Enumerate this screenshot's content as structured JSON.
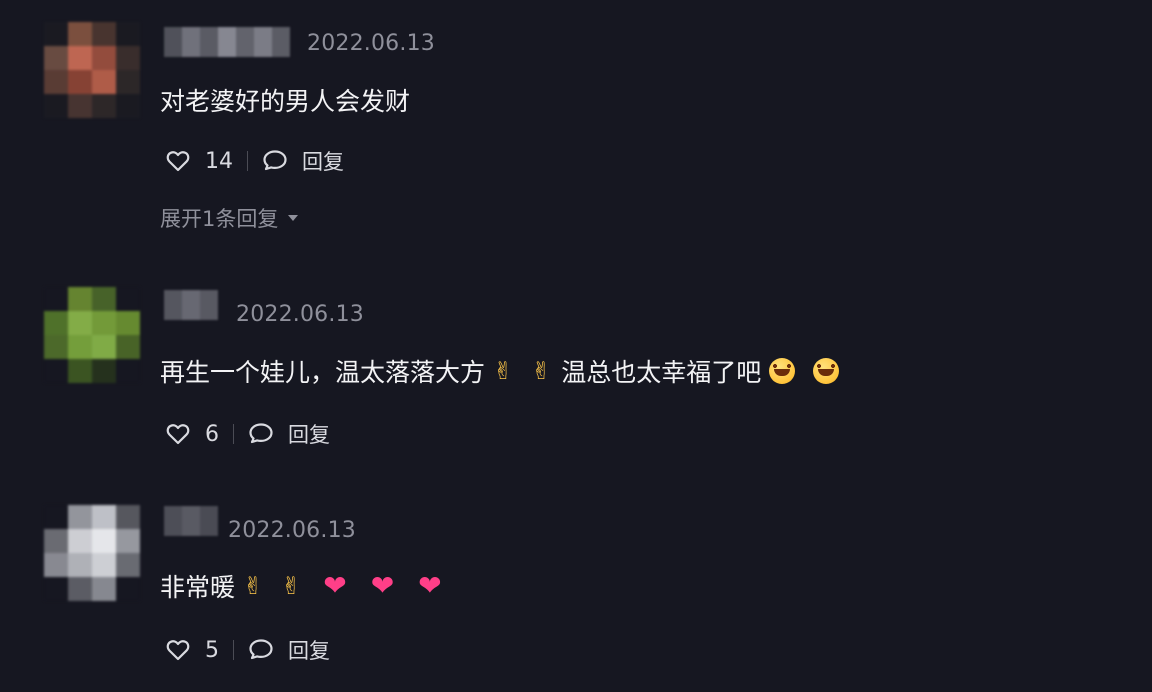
{
  "comments": [
    {
      "date": "2022.06.13",
      "text": "对老婆好的男人会发财",
      "likes": "14",
      "reply_label": "回复",
      "expand_label": "展开1条回复"
    },
    {
      "date": "2022.06.13",
      "text_part1": "再生一个娃儿，温太落落大方",
      "text_part2": "温总也太幸福了吧",
      "likes": "6",
      "reply_label": "回复"
    },
    {
      "date": "2022.06.13",
      "text": "非常暖",
      "likes": "5",
      "reply_label": "回复"
    }
  ],
  "colors": {
    "background": "#161721",
    "date_text": "#8f909b",
    "comment_text": "#f3f3f5",
    "action_text": "#d9dae0",
    "heart_emoji": "#ff3f88"
  },
  "icons": {
    "like": "heart-outline-icon",
    "reply": "speech-bubble-icon",
    "dropdown": "triangle-down-icon",
    "hand_emoji": "finger-heart-emoji",
    "laugh_emoji": "tears-of-joy-emoji",
    "heart_emoji": "pink-heart-emoji"
  }
}
